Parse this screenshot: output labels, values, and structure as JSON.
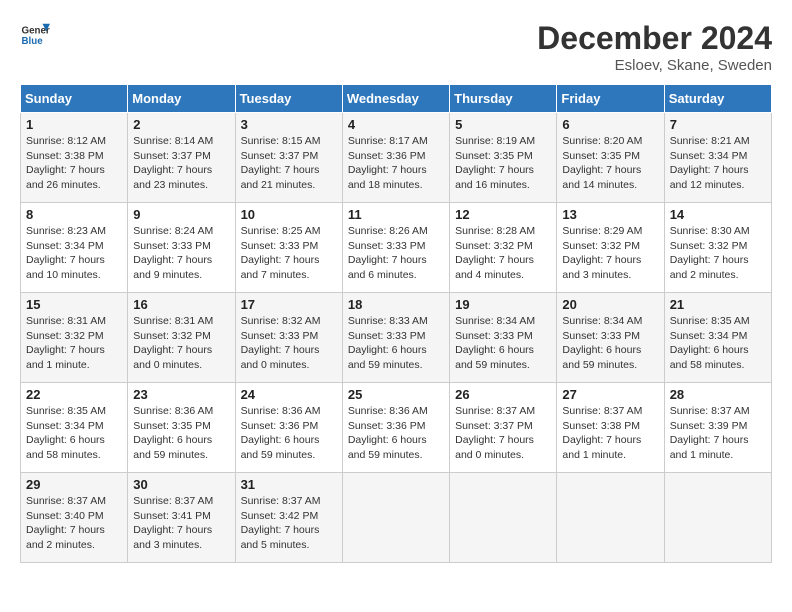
{
  "header": {
    "logo_general": "General",
    "logo_blue": "Blue",
    "month_year": "December 2024",
    "location": "Esloev, Skane, Sweden"
  },
  "days_of_week": [
    "Sunday",
    "Monday",
    "Tuesday",
    "Wednesday",
    "Thursday",
    "Friday",
    "Saturday"
  ],
  "weeks": [
    [
      {
        "day": "1",
        "sunrise": "Sunrise: 8:12 AM",
        "sunset": "Sunset: 3:38 PM",
        "daylight": "Daylight: 7 hours and 26 minutes."
      },
      {
        "day": "2",
        "sunrise": "Sunrise: 8:14 AM",
        "sunset": "Sunset: 3:37 PM",
        "daylight": "Daylight: 7 hours and 23 minutes."
      },
      {
        "day": "3",
        "sunrise": "Sunrise: 8:15 AM",
        "sunset": "Sunset: 3:37 PM",
        "daylight": "Daylight: 7 hours and 21 minutes."
      },
      {
        "day": "4",
        "sunrise": "Sunrise: 8:17 AM",
        "sunset": "Sunset: 3:36 PM",
        "daylight": "Daylight: 7 hours and 18 minutes."
      },
      {
        "day": "5",
        "sunrise": "Sunrise: 8:19 AM",
        "sunset": "Sunset: 3:35 PM",
        "daylight": "Daylight: 7 hours and 16 minutes."
      },
      {
        "day": "6",
        "sunrise": "Sunrise: 8:20 AM",
        "sunset": "Sunset: 3:35 PM",
        "daylight": "Daylight: 7 hours and 14 minutes."
      },
      {
        "day": "7",
        "sunrise": "Sunrise: 8:21 AM",
        "sunset": "Sunset: 3:34 PM",
        "daylight": "Daylight: 7 hours and 12 minutes."
      }
    ],
    [
      {
        "day": "8",
        "sunrise": "Sunrise: 8:23 AM",
        "sunset": "Sunset: 3:34 PM",
        "daylight": "Daylight: 7 hours and 10 minutes."
      },
      {
        "day": "9",
        "sunrise": "Sunrise: 8:24 AM",
        "sunset": "Sunset: 3:33 PM",
        "daylight": "Daylight: 7 hours and 9 minutes."
      },
      {
        "day": "10",
        "sunrise": "Sunrise: 8:25 AM",
        "sunset": "Sunset: 3:33 PM",
        "daylight": "Daylight: 7 hours and 7 minutes."
      },
      {
        "day": "11",
        "sunrise": "Sunrise: 8:26 AM",
        "sunset": "Sunset: 3:33 PM",
        "daylight": "Daylight: 7 hours and 6 minutes."
      },
      {
        "day": "12",
        "sunrise": "Sunrise: 8:28 AM",
        "sunset": "Sunset: 3:32 PM",
        "daylight": "Daylight: 7 hours and 4 minutes."
      },
      {
        "day": "13",
        "sunrise": "Sunrise: 8:29 AM",
        "sunset": "Sunset: 3:32 PM",
        "daylight": "Daylight: 7 hours and 3 minutes."
      },
      {
        "day": "14",
        "sunrise": "Sunrise: 8:30 AM",
        "sunset": "Sunset: 3:32 PM",
        "daylight": "Daylight: 7 hours and 2 minutes."
      }
    ],
    [
      {
        "day": "15",
        "sunrise": "Sunrise: 8:31 AM",
        "sunset": "Sunset: 3:32 PM",
        "daylight": "Daylight: 7 hours and 1 minute."
      },
      {
        "day": "16",
        "sunrise": "Sunrise: 8:31 AM",
        "sunset": "Sunset: 3:32 PM",
        "daylight": "Daylight: 7 hours and 0 minutes."
      },
      {
        "day": "17",
        "sunrise": "Sunrise: 8:32 AM",
        "sunset": "Sunset: 3:33 PM",
        "daylight": "Daylight: 7 hours and 0 minutes."
      },
      {
        "day": "18",
        "sunrise": "Sunrise: 8:33 AM",
        "sunset": "Sunset: 3:33 PM",
        "daylight": "Daylight: 6 hours and 59 minutes."
      },
      {
        "day": "19",
        "sunrise": "Sunrise: 8:34 AM",
        "sunset": "Sunset: 3:33 PM",
        "daylight": "Daylight: 6 hours and 59 minutes."
      },
      {
        "day": "20",
        "sunrise": "Sunrise: 8:34 AM",
        "sunset": "Sunset: 3:33 PM",
        "daylight": "Daylight: 6 hours and 59 minutes."
      },
      {
        "day": "21",
        "sunrise": "Sunrise: 8:35 AM",
        "sunset": "Sunset: 3:34 PM",
        "daylight": "Daylight: 6 hours and 58 minutes."
      }
    ],
    [
      {
        "day": "22",
        "sunrise": "Sunrise: 8:35 AM",
        "sunset": "Sunset: 3:34 PM",
        "daylight": "Daylight: 6 hours and 58 minutes."
      },
      {
        "day": "23",
        "sunrise": "Sunrise: 8:36 AM",
        "sunset": "Sunset: 3:35 PM",
        "daylight": "Daylight: 6 hours and 59 minutes."
      },
      {
        "day": "24",
        "sunrise": "Sunrise: 8:36 AM",
        "sunset": "Sunset: 3:36 PM",
        "daylight": "Daylight: 6 hours and 59 minutes."
      },
      {
        "day": "25",
        "sunrise": "Sunrise: 8:36 AM",
        "sunset": "Sunset: 3:36 PM",
        "daylight": "Daylight: 6 hours and 59 minutes."
      },
      {
        "day": "26",
        "sunrise": "Sunrise: 8:37 AM",
        "sunset": "Sunset: 3:37 PM",
        "daylight": "Daylight: 7 hours and 0 minutes."
      },
      {
        "day": "27",
        "sunrise": "Sunrise: 8:37 AM",
        "sunset": "Sunset: 3:38 PM",
        "daylight": "Daylight: 7 hours and 1 minute."
      },
      {
        "day": "28",
        "sunrise": "Sunrise: 8:37 AM",
        "sunset": "Sunset: 3:39 PM",
        "daylight": "Daylight: 7 hours and 1 minute."
      }
    ],
    [
      {
        "day": "29",
        "sunrise": "Sunrise: 8:37 AM",
        "sunset": "Sunset: 3:40 PM",
        "daylight": "Daylight: 7 hours and 2 minutes."
      },
      {
        "day": "30",
        "sunrise": "Sunrise: 8:37 AM",
        "sunset": "Sunset: 3:41 PM",
        "daylight": "Daylight: 7 hours and 3 minutes."
      },
      {
        "day": "31",
        "sunrise": "Sunrise: 8:37 AM",
        "sunset": "Sunset: 3:42 PM",
        "daylight": "Daylight: 7 hours and 5 minutes."
      },
      null,
      null,
      null,
      null
    ]
  ]
}
